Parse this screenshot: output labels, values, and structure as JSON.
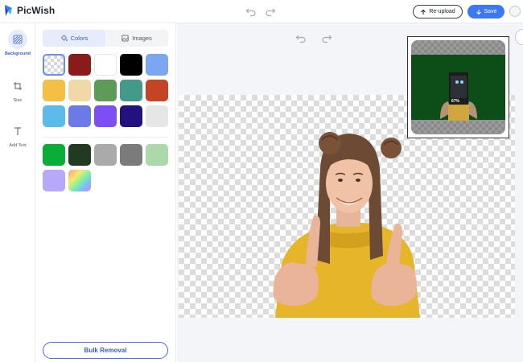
{
  "app": {
    "name": "PicWish"
  },
  "topbar": {
    "reupload_label": "Re-upload",
    "save_label": "Save"
  },
  "rail": {
    "items": [
      {
        "label": "Background",
        "icon": "background-icon",
        "active": true
      },
      {
        "label": "Size",
        "icon": "crop-icon",
        "active": false
      },
      {
        "label": "Add Text",
        "icon": "text-icon",
        "active": false
      }
    ]
  },
  "panel": {
    "tabs": [
      {
        "label": "Colors",
        "icon": "paint-bucket-icon",
        "active": true
      },
      {
        "label": "Images",
        "icon": "image-icon",
        "active": false
      }
    ],
    "solid_colors": [
      "transparent",
      "#8b1a1a",
      "#ffffff",
      "#000000",
      "#7aa7ef",
      "#f3bf45",
      "#f3d8a7",
      "#5e9b58",
      "#429a8a",
      "#c44526",
      "#5bbbe9",
      "#6a7be8",
      "#7d4ef2",
      "#22117f",
      "#e6e6e6"
    ],
    "extra_colors": [
      "#0aae37",
      "#223a22",
      "#aaaaaa",
      "#7b7b7b",
      "#abd9a9",
      "#b7a8f8",
      "gradient"
    ],
    "bulk_label": "Bulk Removal"
  },
  "preview": {
    "progress_text": "67%",
    "background_color": "#0c4d18"
  }
}
